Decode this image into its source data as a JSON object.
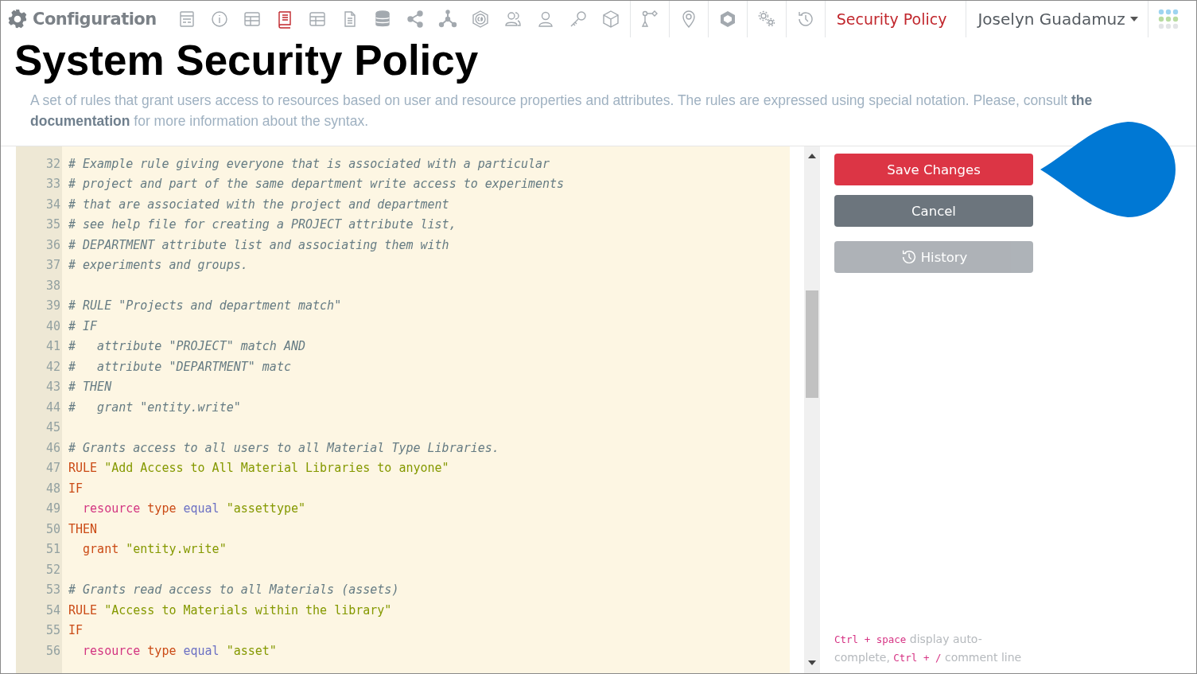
{
  "navbar": {
    "brand": "Configuration",
    "toolbar_groups": [
      [
        {
          "kind": "layout",
          "selected": false
        },
        {
          "kind": "info",
          "selected": false
        },
        {
          "kind": "table",
          "selected": false
        },
        {
          "kind": "book",
          "selected": true
        },
        {
          "kind": "grid",
          "selected": false
        },
        {
          "kind": "document",
          "selected": false
        },
        {
          "kind": "database",
          "selected": false
        },
        {
          "kind": "share",
          "selected": false
        },
        {
          "kind": "network",
          "selected": false
        },
        {
          "kind": "cd",
          "selected": false
        },
        {
          "kind": "users",
          "selected": false
        },
        {
          "kind": "user",
          "selected": false
        },
        {
          "kind": "key",
          "selected": false
        },
        {
          "kind": "cube",
          "selected": false
        }
      ],
      [
        {
          "kind": "branch",
          "selected": false
        }
      ],
      [
        {
          "kind": "pin",
          "selected": false
        }
      ],
      [
        {
          "kind": "shield",
          "selected": false
        }
      ],
      [
        {
          "kind": "gears",
          "selected": false
        }
      ],
      [
        {
          "kind": "history",
          "selected": false
        }
      ]
    ],
    "current_page": "Security Policy",
    "user": "Joselyn Guadamuz"
  },
  "title": "System Security Policy",
  "description": "A set of rules that grant users access to resources based on user and resource properties and attributes. The rules are expressed using special notation. Please, consult **the documentation** for more information about the syntax.",
  "editor": {
    "lines": [
      {
        "number": "32",
        "tokens": [
          {
            "kind": "comment",
            "text": "# Example rule giving everyone that is associated with a particular"
          }
        ]
      },
      {
        "number": "33",
        "tokens": [
          {
            "kind": "comment",
            "text": "# project and part of the same department write access to experiments"
          }
        ]
      },
      {
        "number": "34",
        "tokens": [
          {
            "kind": "comment",
            "text": "# that are associated with the project and department"
          }
        ]
      },
      {
        "number": "35",
        "tokens": [
          {
            "kind": "comment",
            "text": "# see help file for creating a PROJECT attribute list,"
          }
        ]
      },
      {
        "number": "36",
        "tokens": [
          {
            "kind": "comment",
            "text": "# DEPARTMENT attribute list and associating them with"
          }
        ]
      },
      {
        "number": "37",
        "tokens": [
          {
            "kind": "comment",
            "text": "# experiments and groups."
          }
        ]
      },
      {
        "number": "38"
      },
      {
        "number": "39",
        "tokens": [
          {
            "kind": "comment",
            "text": "# RULE \"Projects and department match\""
          }
        ]
      },
      {
        "number": "40",
        "tokens": [
          {
            "kind": "comment",
            "text": "# IF"
          }
        ]
      },
      {
        "number": "41",
        "tokens": [
          {
            "kind": "comment",
            "text": "#   attribute \"PROJECT\" match AND"
          }
        ]
      },
      {
        "number": "42",
        "tokens": [
          {
            "kind": "comment",
            "text": "#   attribute \"DEPARTMENT\" matc"
          }
        ]
      },
      {
        "number": "43",
        "tokens": [
          {
            "kind": "comment",
            "text": "# THEN"
          }
        ]
      },
      {
        "number": "44",
        "tokens": [
          {
            "kind": "comment",
            "text": "#   grant \"entity.write\""
          }
        ]
      },
      {
        "number": "45"
      },
      {
        "number": "46",
        "tokens": [
          {
            "kind": "comment",
            "text": "# Grants access to all users to all Material Type Libraries."
          }
        ]
      },
      {
        "number": "47",
        "tokens": [
          {
            "kind": "keyword",
            "text": "RULE"
          },
          {
            "kind": "string",
            "text": " \"Add Access to All Material Libraries to anyone\""
          }
        ]
      },
      {
        "number": "48",
        "tokens": [
          {
            "kind": "keyword",
            "text": "IF"
          }
        ]
      },
      {
        "number": "49",
        "tokens": [
          {
            "kind": "subject",
            "text": "  resource"
          },
          {
            "kind": "attribute",
            "text": " type"
          },
          {
            "kind": "operator",
            "text": " equal"
          },
          {
            "kind": "string",
            "text": " \"assettype\""
          }
        ]
      },
      {
        "number": "50",
        "tokens": [
          {
            "kind": "keyword",
            "text": "THEN"
          }
        ]
      },
      {
        "number": "51",
        "tokens": [
          {
            "kind": "action",
            "text": "  grant"
          },
          {
            "kind": "string",
            "text": " \"entity.write\""
          }
        ]
      },
      {
        "number": "52"
      },
      {
        "number": "53",
        "tokens": [
          {
            "kind": "comment",
            "text": "# Grants read access to all Materials (assets)"
          }
        ]
      },
      {
        "number": "54",
        "tokens": [
          {
            "kind": "keyword",
            "text": "RULE"
          },
          {
            "kind": "string",
            "text": " \"Access to Materials within the library\""
          }
        ]
      },
      {
        "number": "55",
        "tokens": [
          {
            "kind": "keyword",
            "text": "IF"
          }
        ]
      },
      {
        "number": "56",
        "tokens": [
          {
            "kind": "subject",
            "text": "  resource"
          },
          {
            "kind": "attribute",
            "text": " type"
          },
          {
            "kind": "operator",
            "text": " equal"
          },
          {
            "kind": "string",
            "text": " \"asset\""
          }
        ]
      }
    ]
  },
  "actions": [
    {
      "kind": "primary",
      "label": "Save Changes",
      "disabled": false
    },
    {
      "kind": "secondary",
      "label": "Cancel",
      "disabled": false
    },
    {
      "kind": "history",
      "label": "History",
      "disabled": true
    }
  ],
  "hint": [
    {
      "kind": "key",
      "text": "Ctrl + space"
    },
    {
      "kind": "text",
      "text": " display auto-complete, "
    },
    {
      "kind": "key",
      "text": "Ctrl + /"
    },
    {
      "kind": "text",
      "text": " comment line"
    }
  ]
}
